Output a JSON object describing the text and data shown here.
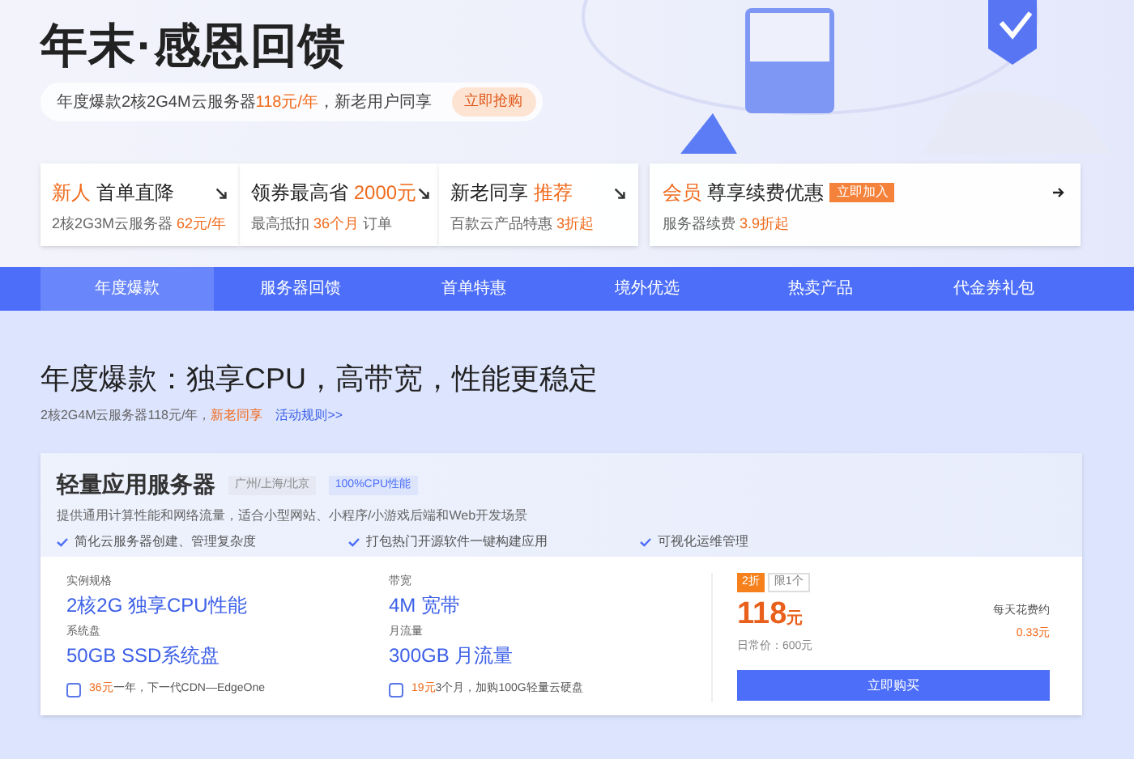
{
  "banner": {
    "title": "年末·感恩回馈",
    "subtitle": {
      "before": "年度爆款2核2G4M云服务器",
      "price": "118元/年",
      "after": "，新老用户同享"
    },
    "cta": "立即抢购"
  },
  "promo_cards": [
    {
      "kind": "arrow",
      "head_accent": "新人",
      "head": "首单直降",
      "desc": "2核2G3M云服务器",
      "desc_accent": "62元/年"
    },
    {
      "kind": "arrow",
      "head": "领券最高省",
      "head_accent_after": "2000元",
      "desc": "最高抵扣",
      "desc_accent": "36个月",
      "desc_after": "订单"
    },
    {
      "kind": "arrow",
      "head": "新老同享",
      "head_accent_after": "推荐",
      "desc": "百款云产品特惠",
      "desc_accent": "3折起"
    },
    {
      "kind": "member",
      "head_accent": "会员",
      "head": "尊享续费优惠",
      "badge": "立即加入",
      "desc": "服务器续费",
      "desc_accent": "3.9折起"
    }
  ],
  "tabs": [
    {
      "label": "年度爆款",
      "selected": true
    },
    {
      "label": "服务器回馈",
      "selected": false
    },
    {
      "label": "首单特惠",
      "selected": false
    },
    {
      "label": "境外优选",
      "selected": false
    },
    {
      "label": "热卖产品",
      "selected": false
    },
    {
      "label": "代金券礼包",
      "selected": false
    }
  ],
  "section": {
    "title": "年度爆款：独享CPU，高带宽，性能更稳定",
    "note": "2核2G4M云服务器118元/年，",
    "note_accent": "新老同享",
    "link": "活动规则>>"
  },
  "product": {
    "name": "轻量应用服务器",
    "tags": [
      "广州/上海/北京",
      "100%CPU性能"
    ],
    "description": "提供通用计算性能和网络流量，适合小型网站、小程序/小游戏后端和Web开发场景",
    "features": [
      "简化云服务器创建、管理复杂度",
      "打包热门开源软件一键构建应用",
      "可视化运维管理"
    ],
    "specs": [
      {
        "label": "实例规格",
        "value": "2核2G 独享CPU性能"
      },
      {
        "label": "带宽",
        "value": "4M 宽带"
      },
      {
        "label": "系统盘",
        "value": "50GB SSD系统盘"
      },
      {
        "label": "月流量",
        "value": "300GB 月流量"
      }
    ],
    "addons": [
      {
        "price": "36元",
        "text": "一年，下一代CDN—EdgeOne",
        "checked": false
      },
      {
        "price": "19元",
        "text": "3个月，加购100G轻量云硬盘",
        "checked": false
      }
    ],
    "discount": "2折",
    "limit": "限1个",
    "price": "118",
    "unit": "元",
    "regular": "日常价：600元",
    "daily_label": "每天花费约",
    "daily": "0.33元",
    "buy": "立即购买"
  }
}
